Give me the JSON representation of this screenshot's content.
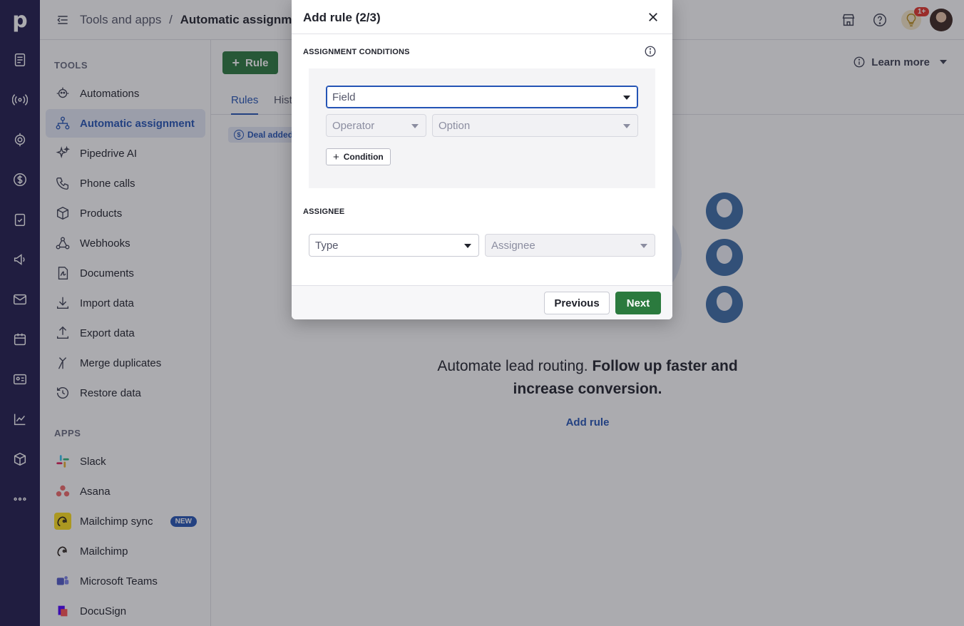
{
  "header": {
    "breadcrumb_parent": "Tools and apps",
    "breadcrumb_sep": "/",
    "breadcrumb_current": "Automatic assignment",
    "notification_count": "1+"
  },
  "sidebar": {
    "tools_heading": "TOOLS",
    "tools": [
      {
        "label": "Automations",
        "icon": "robot-icon"
      },
      {
        "label": "Automatic assignment",
        "icon": "assignment-icon",
        "active": true
      },
      {
        "label": "Pipedrive AI",
        "icon": "sparkle-icon"
      },
      {
        "label": "Phone calls",
        "icon": "phone-icon"
      },
      {
        "label": "Products",
        "icon": "box-icon"
      },
      {
        "label": "Webhooks",
        "icon": "webhook-icon"
      },
      {
        "label": "Documents",
        "icon": "document-icon"
      },
      {
        "label": "Import data",
        "icon": "import-icon"
      },
      {
        "label": "Export data",
        "icon": "export-icon"
      },
      {
        "label": "Merge duplicates",
        "icon": "merge-icon"
      },
      {
        "label": "Restore data",
        "icon": "restore-icon"
      }
    ],
    "apps_heading": "APPS",
    "apps": [
      {
        "label": "Slack",
        "icon": "slack-icon"
      },
      {
        "label": "Asana",
        "icon": "asana-icon"
      },
      {
        "label": "Mailchimp sync",
        "icon": "mailchimp-icon",
        "badge": "NEW"
      },
      {
        "label": "Mailchimp",
        "icon": "mailchimp-icon"
      },
      {
        "label": "Microsoft Teams",
        "icon": "teams-icon"
      },
      {
        "label": "DocuSign",
        "icon": "docusign-icon"
      }
    ]
  },
  "main": {
    "add_button": "Rule",
    "learn_more": "Learn more",
    "tabs": [
      "Rules",
      "Hist"
    ],
    "filter_chip": "Deal added",
    "headline_plain": "Automate lead routing. ",
    "headline_bold_1": "Follow up faster and",
    "headline_bold_2": "increase conversion.",
    "add_rule_link": "Add rule"
  },
  "modal": {
    "title": "Add rule (2/3)",
    "conditions_heading": "ASSIGNMENT CONDITIONS",
    "field_placeholder": "Field",
    "operator_placeholder": "Operator",
    "option_placeholder": "Option",
    "condition_button": "Condition",
    "assignee_heading": "ASSIGNEE",
    "type_placeholder": "Type",
    "assignee_placeholder": "Assignee",
    "previous_button": "Previous",
    "next_button": "Next"
  },
  "colors": {
    "rail": "#1f1b4d",
    "accent": "#2454b5",
    "primary_green": "#2b7a3e"
  }
}
